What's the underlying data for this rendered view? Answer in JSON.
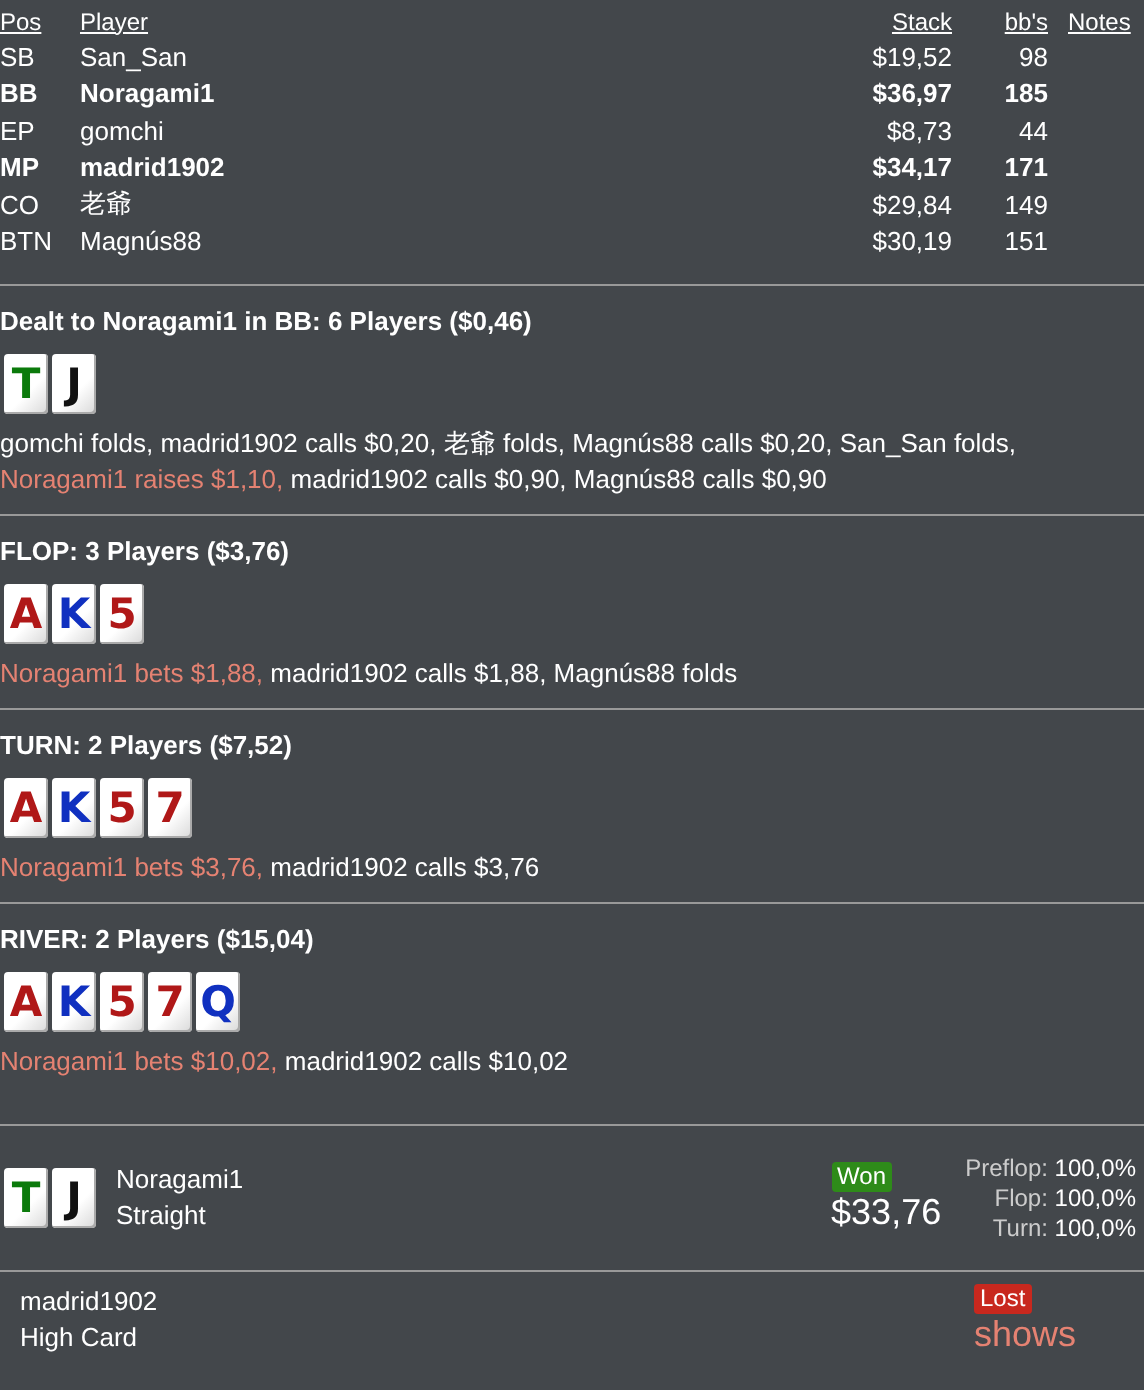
{
  "players": {
    "columns": [
      "Pos",
      "Player",
      "Stack",
      "bb's",
      "Notes"
    ],
    "rows": [
      {
        "pos": "SB",
        "name": "San_San",
        "stack": "$19,52",
        "bbs": "98",
        "highlight": false
      },
      {
        "pos": "BB",
        "name": "Noragami1",
        "stack": "$36,97",
        "bbs": "185",
        "highlight": true
      },
      {
        "pos": "EP",
        "name": "gomchi",
        "stack": "$8,73",
        "bbs": "44",
        "highlight": false
      },
      {
        "pos": "MP",
        "name": "madrid1902",
        "stack": "$34,17",
        "bbs": "171",
        "highlight": true
      },
      {
        "pos": "CO",
        "name": "老爺",
        "stack": "$29,84",
        "bbs": "149",
        "highlight": false
      },
      {
        "pos": "BTN",
        "name": "Magnús88",
        "stack": "$30,19",
        "bbs": "151",
        "highlight": false
      }
    ]
  },
  "streets": [
    {
      "title": "Dealt to Noragami1 in BB: 6 Players ($0,46)",
      "cards": [
        {
          "rank": "T",
          "color": "#0b7a0b"
        },
        {
          "rank": "J",
          "color": "#111111"
        }
      ],
      "actions": [
        {
          "text": "gomchi folds, madrid1902 calls $0,20, 老爺 folds, Magnús88 calls $0,20, San_San folds,",
          "hero": false
        },
        {
          "text": "Noragami1 raises $1,10,",
          "hero": true
        },
        {
          "text": "madrid1902 calls $0,90, Magnús88 calls $0,90",
          "hero": false
        }
      ]
    },
    {
      "title": "FLOP: 3 Players ($3,76)",
      "cards": [
        {
          "rank": "A",
          "color": "#b01818"
        },
        {
          "rank": "K",
          "color": "#1030c0"
        },
        {
          "rank": "5",
          "color": "#b01818"
        }
      ],
      "actions": [
        {
          "text": "Noragami1 bets $1,88,",
          "hero": true
        },
        {
          "text": "madrid1902 calls $1,88, Magnús88 folds",
          "hero": false
        }
      ]
    },
    {
      "title": "TURN: 2 Players ($7,52)",
      "cards": [
        {
          "rank": "A",
          "color": "#b01818"
        },
        {
          "rank": "K",
          "color": "#1030c0"
        },
        {
          "rank": "5",
          "color": "#b01818"
        },
        {
          "rank": "7",
          "color": "#b01818"
        }
      ],
      "actions": [
        {
          "text": "Noragami1 bets $3,76,",
          "hero": true
        },
        {
          "text": "madrid1902 calls $3,76",
          "hero": false
        }
      ]
    },
    {
      "title": "RIVER: 2 Players ($15,04)",
      "cards": [
        {
          "rank": "A",
          "color": "#b01818"
        },
        {
          "rank": "K",
          "color": "#1030c0"
        },
        {
          "rank": "5",
          "color": "#b01818"
        },
        {
          "rank": "7",
          "color": "#b01818"
        },
        {
          "rank": "Q",
          "color": "#1030c0"
        }
      ],
      "actions": [
        {
          "text": "Noragami1 bets $10,02,",
          "hero": true
        },
        {
          "text": "madrid1902 calls $10,02",
          "hero": false
        }
      ]
    }
  ],
  "results": [
    {
      "cards": [
        {
          "rank": "T",
          "color": "#0b7a0b"
        },
        {
          "rank": "J",
          "color": "#111111"
        }
      ],
      "name": "Noragami1",
      "hand": "Straight",
      "won": true,
      "badge": "Won",
      "amount": "$33,76",
      "equity": [
        {
          "label": "Preflop:",
          "value": "100,0%"
        },
        {
          "label": "Flop:",
          "value": "100,0%"
        },
        {
          "label": "Turn:",
          "value": "100,0%"
        }
      ]
    },
    {
      "name": "madrid1902",
      "hand": "High Card",
      "won": false,
      "badge": "Lost",
      "amount": "shows"
    }
  ]
}
